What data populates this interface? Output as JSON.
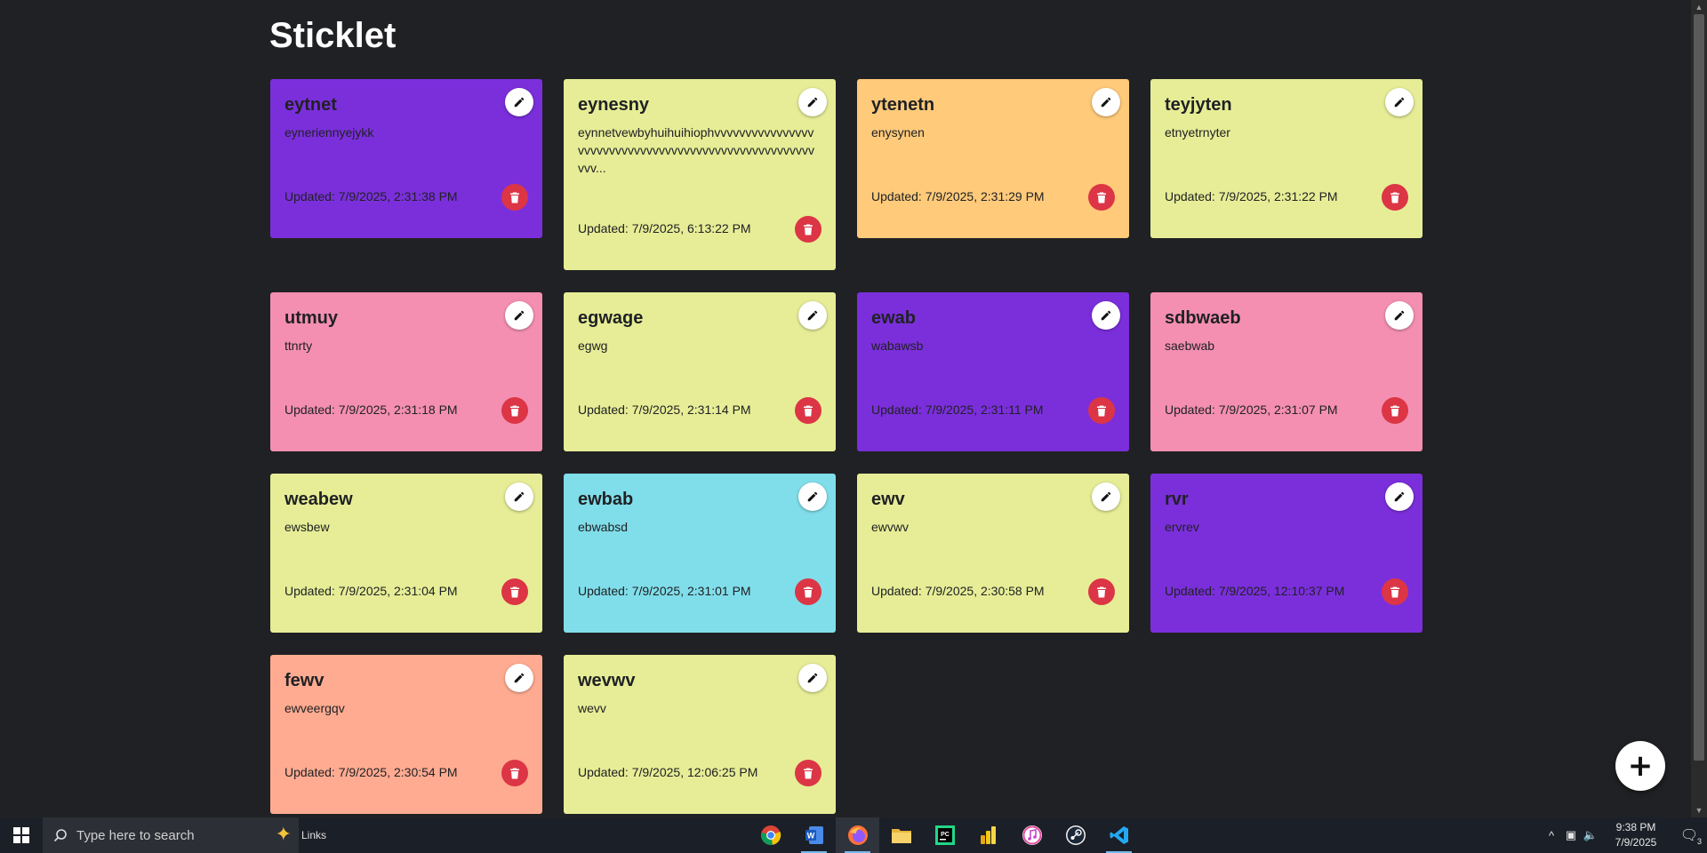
{
  "app": {
    "title": "Sticklet",
    "add_button": "+"
  },
  "colors": {
    "purple": "#7b2fdb",
    "lime": "#e6ed96",
    "orange": "#ffca7a",
    "pink": "#f48fb1",
    "cyan": "#80deea",
    "salmon": "#ffab91",
    "delete": "#dc3545"
  },
  "notes": [
    {
      "title": "eytnet",
      "content": "eyneriennyejykk",
      "updated": "Updated: 7/9/2025, 2:31:38 PM",
      "color": "#7b2fdb"
    },
    {
      "title": "eynesny",
      "content": "eynnetvewbyhuihuihiophvvvvvvvvvvvvvvvvvvvvvvvvvvvvvvvvvvvvvvvvvvvvvvvvvvvvvvvvv...",
      "updated": "Updated: 7/9/2025, 6:13:22 PM",
      "color": "#e6ed96"
    },
    {
      "title": "ytenetn",
      "content": "enysynen",
      "updated": "Updated: 7/9/2025, 2:31:29 PM",
      "color": "#ffca7a"
    },
    {
      "title": "teyjyten",
      "content": "etnyetrnyter",
      "updated": "Updated: 7/9/2025, 2:31:22 PM",
      "color": "#e6ed96"
    },
    {
      "title": "utmuy",
      "content": "ttnrty",
      "updated": "Updated: 7/9/2025, 2:31:18 PM",
      "color": "#f48fb1"
    },
    {
      "title": "egwage",
      "content": "egwg",
      "updated": "Updated: 7/9/2025, 2:31:14 PM",
      "color": "#e6ed96"
    },
    {
      "title": "ewab",
      "content": "wabawsb",
      "updated": "Updated: 7/9/2025, 2:31:11 PM",
      "color": "#7b2fdb"
    },
    {
      "title": "sdbwaeb",
      "content": "saebwab",
      "updated": "Updated: 7/9/2025, 2:31:07 PM",
      "color": "#f48fb1"
    },
    {
      "title": "weabew",
      "content": "ewsbew",
      "updated": "Updated: 7/9/2025, 2:31:04 PM",
      "color": "#e6ed96"
    },
    {
      "title": "ewbab",
      "content": "ebwabsd",
      "updated": "Updated: 7/9/2025, 2:31:01 PM",
      "color": "#80deea"
    },
    {
      "title": "ewv",
      "content": "ewvwv",
      "updated": "Updated: 7/9/2025, 2:30:58 PM",
      "color": "#e6ed96"
    },
    {
      "title": "rvr",
      "content": "ervrev",
      "updated": "Updated: 7/9/2025, 12:10:37 PM",
      "color": "#7b2fdb"
    },
    {
      "title": "fewv",
      "content": "ewveergqv",
      "updated": "Updated: 7/9/2025, 2:30:54 PM",
      "color": "#ffab91"
    },
    {
      "title": "wevwv",
      "content": "wevv",
      "updated": "Updated: 7/9/2025, 12:06:25 PM",
      "color": "#e6ed96"
    }
  ],
  "taskbar": {
    "search_placeholder": "Type here to search",
    "links_label": "Links",
    "apps": [
      "chrome-icon",
      "word-icon",
      "firefox-icon",
      "file-explorer-icon",
      "pycharm-icon",
      "power-bi-icon",
      "itunes-icon",
      "steam-icon",
      "vscode-icon"
    ],
    "time": "9:38 PM",
    "date": "7/9/2025",
    "notification_count": "3"
  }
}
